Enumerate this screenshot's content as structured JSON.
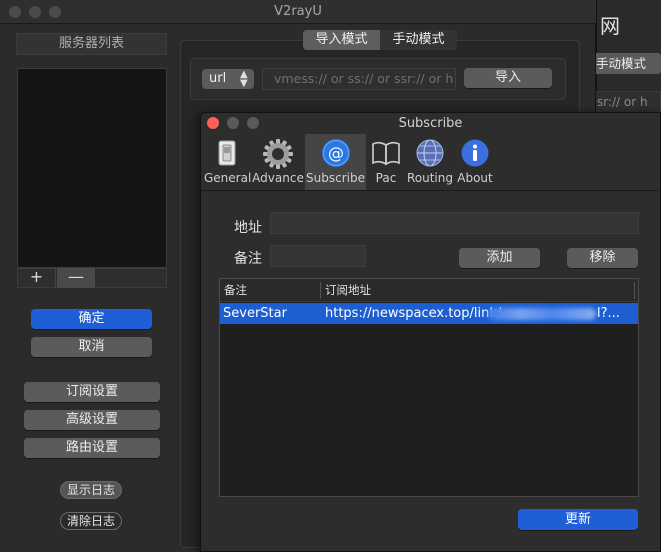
{
  "background_window": {
    "title_fragment": "网",
    "segment_label": "手动模式",
    "input_placeholder": "sr:// or h"
  },
  "main_window": {
    "title": "V2rayU",
    "server_list_title": "服务器列表",
    "add_server": "+",
    "remove_server": "—",
    "confirm": "确定",
    "cancel": "取消",
    "subscribe_settings": "订阅设置",
    "advance_settings": "高级设置",
    "routing_settings": "路由设置",
    "show_log": "显示日志",
    "clear_log": "清除日志",
    "mode_tabs": [
      "导入模式",
      "手动模式"
    ],
    "selected_mode": "导入模式",
    "protocol_select": "url",
    "import_placeholder": "vmess:// or ss:// or ssr:// or h",
    "import_button": "导入"
  },
  "subscribe_window": {
    "title": "Subscribe",
    "toolbar": [
      {
        "label": "General",
        "icon": "switch-icon"
      },
      {
        "label": "Advance",
        "icon": "gear-icon"
      },
      {
        "label": "Subscribe",
        "icon": "at-sign-icon"
      },
      {
        "label": "Pac",
        "icon": "book-icon"
      },
      {
        "label": "Routing",
        "icon": "globe-icon"
      },
      {
        "label": "About",
        "icon": "info-icon"
      }
    ],
    "selected_tab": "Subscribe",
    "address_label": "地址",
    "remark_label": "备注",
    "address_value": "",
    "remark_value": "",
    "add_button": "添加",
    "remove_button": "移除",
    "table": {
      "columns": [
        "备注",
        "订阅地址"
      ],
      "rows": [
        {
          "remark": "SeverStar",
          "url_visible": "https://newspacex.top/link/",
          "url_tail": "l?...",
          "selected": true
        }
      ]
    },
    "update_button": "更新"
  },
  "colors": {
    "accent_blue": "#1f5fd6",
    "close_red": "#fe5f57",
    "window_bg": "#2b2b2b"
  }
}
